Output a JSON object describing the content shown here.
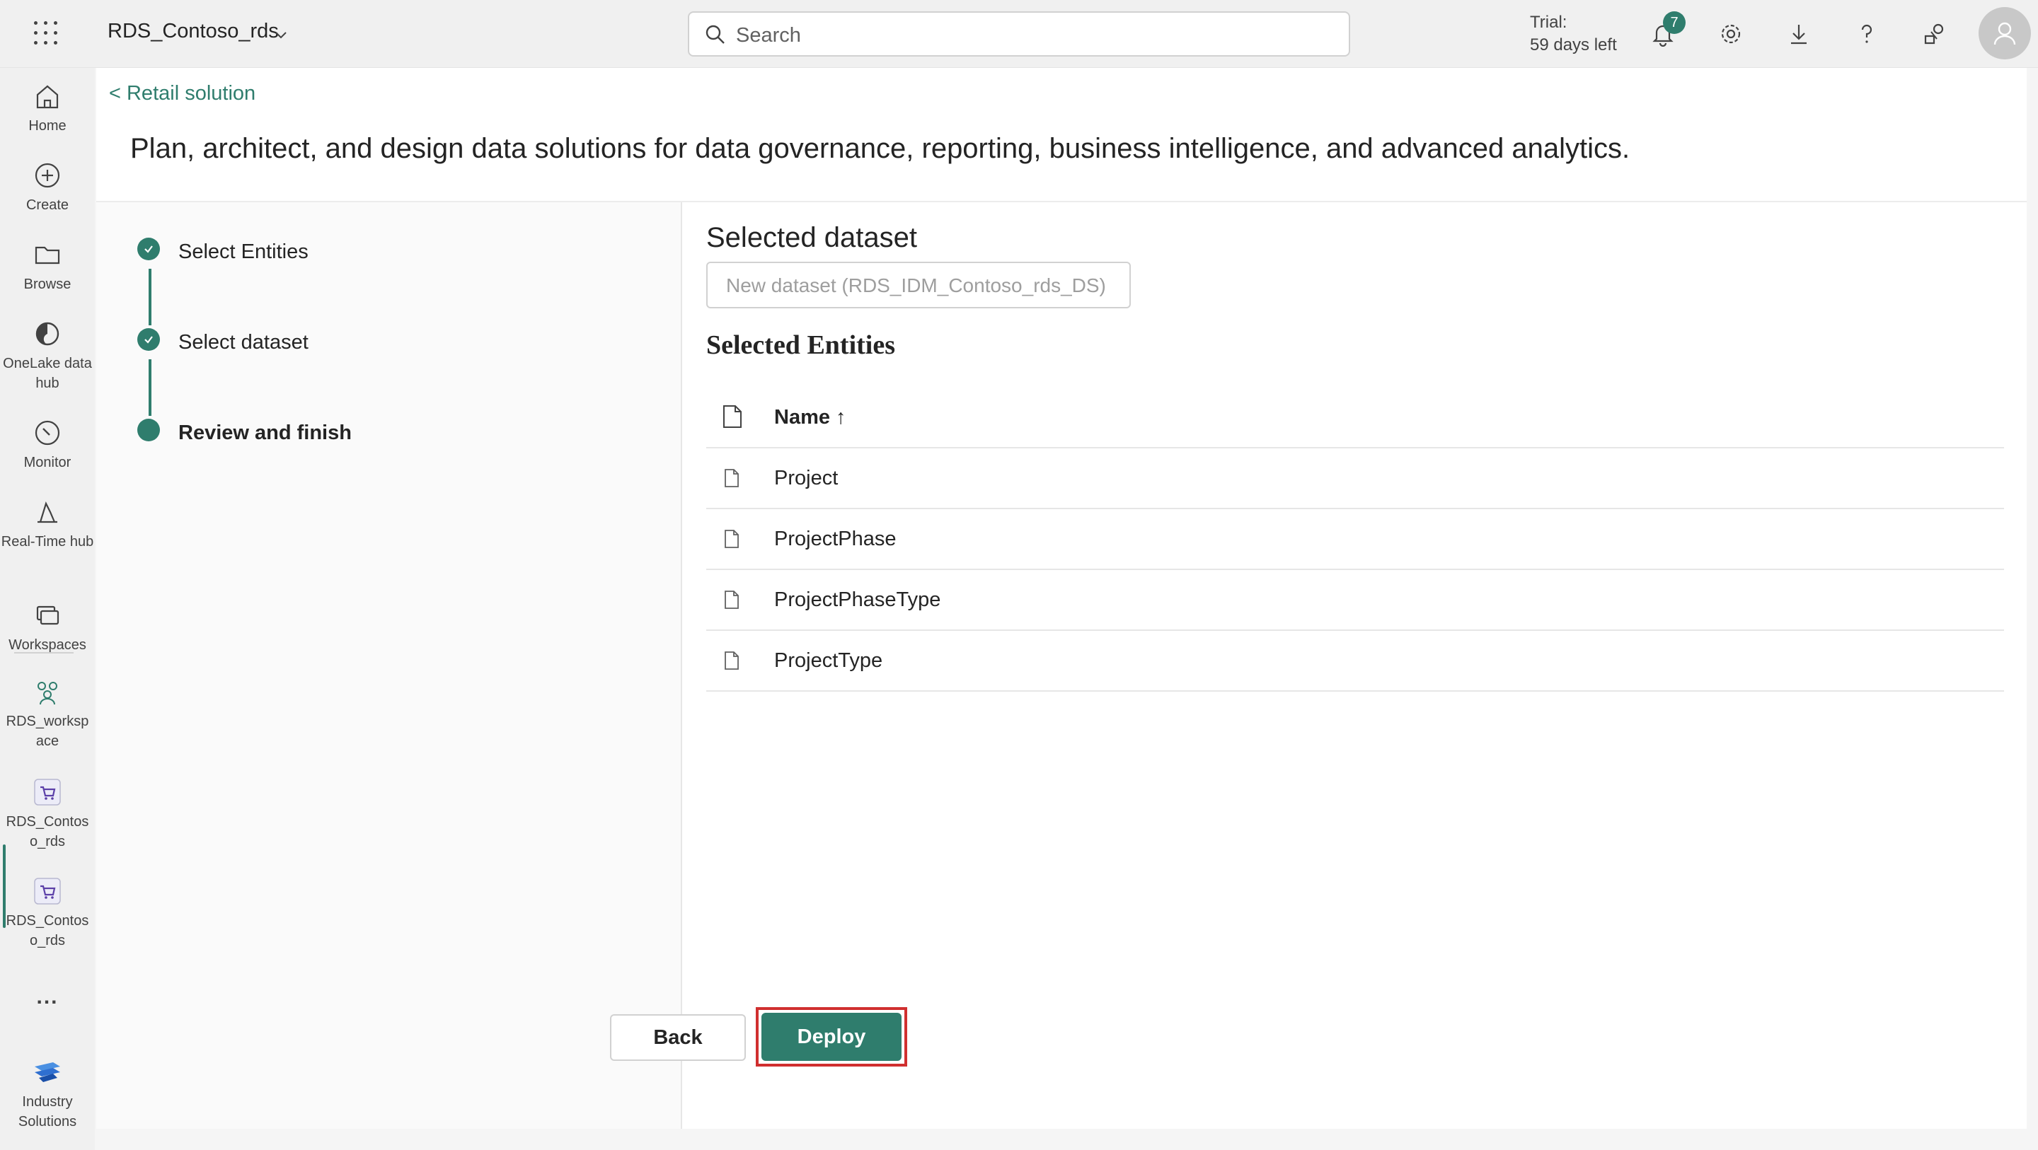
{
  "topbar": {
    "app_title": "RDS_Contoso_rds",
    "search_placeholder": "Search",
    "trial_line1": "Trial:",
    "trial_line2": "59 days left",
    "notification_count": "7",
    "icons": [
      "app-launcher-icon",
      "chevron-down-icon",
      "search-icon",
      "bell-icon",
      "gear-icon",
      "download-icon",
      "help-icon",
      "share-feedback-icon",
      "person-icon"
    ]
  },
  "rail": {
    "items": [
      {
        "label": "Home",
        "icon": "home-icon"
      },
      {
        "label": "Create",
        "icon": "plus-circle-icon"
      },
      {
        "label": "Browse",
        "icon": "folder-icon"
      },
      {
        "label": "OneLake data hub",
        "icon": "onelake-icon"
      },
      {
        "label": "Monitor",
        "icon": "monitor-icon"
      },
      {
        "label": "Real-Time hub",
        "icon": "realtime-icon"
      },
      {
        "label": "Workspaces",
        "icon": "workspaces-icon"
      },
      {
        "label": "RDS_worksp ace",
        "icon": "workspace-people-icon"
      },
      {
        "label": "RDS_Contos o_rds",
        "icon": "cart-icon"
      },
      {
        "label": "RDS_Contos o_rds",
        "icon": "cart-icon"
      },
      {
        "label": "...",
        "icon": "more-icon"
      },
      {
        "label": "Industry Solutions",
        "icon": "industry-solutions-icon"
      }
    ]
  },
  "main": {
    "breadcrumb": "< Retail solution",
    "title": "Plan, architect, and design data solutions for data governance, reporting, business intelligence, and advanced analytics.",
    "steps": [
      {
        "label": "Select Entities",
        "state": "done"
      },
      {
        "label": "Select dataset",
        "state": "done"
      },
      {
        "label": "Review and finish",
        "state": "current"
      }
    ],
    "selected_dataset_heading": "Selected dataset",
    "dataset_input_value": "New dataset (RDS_IDM_Contoso_rds_DS)",
    "selected_entities_heading": "Selected Entities",
    "table": {
      "header": "Name ↑",
      "rows": [
        "Project",
        "ProjectPhase",
        "ProjectPhaseType",
        "ProjectType"
      ]
    },
    "back_label": "Back",
    "deploy_label": "Deploy"
  },
  "colors": {
    "accent": "#2f7d6d",
    "highlight": "#d02f2f"
  }
}
